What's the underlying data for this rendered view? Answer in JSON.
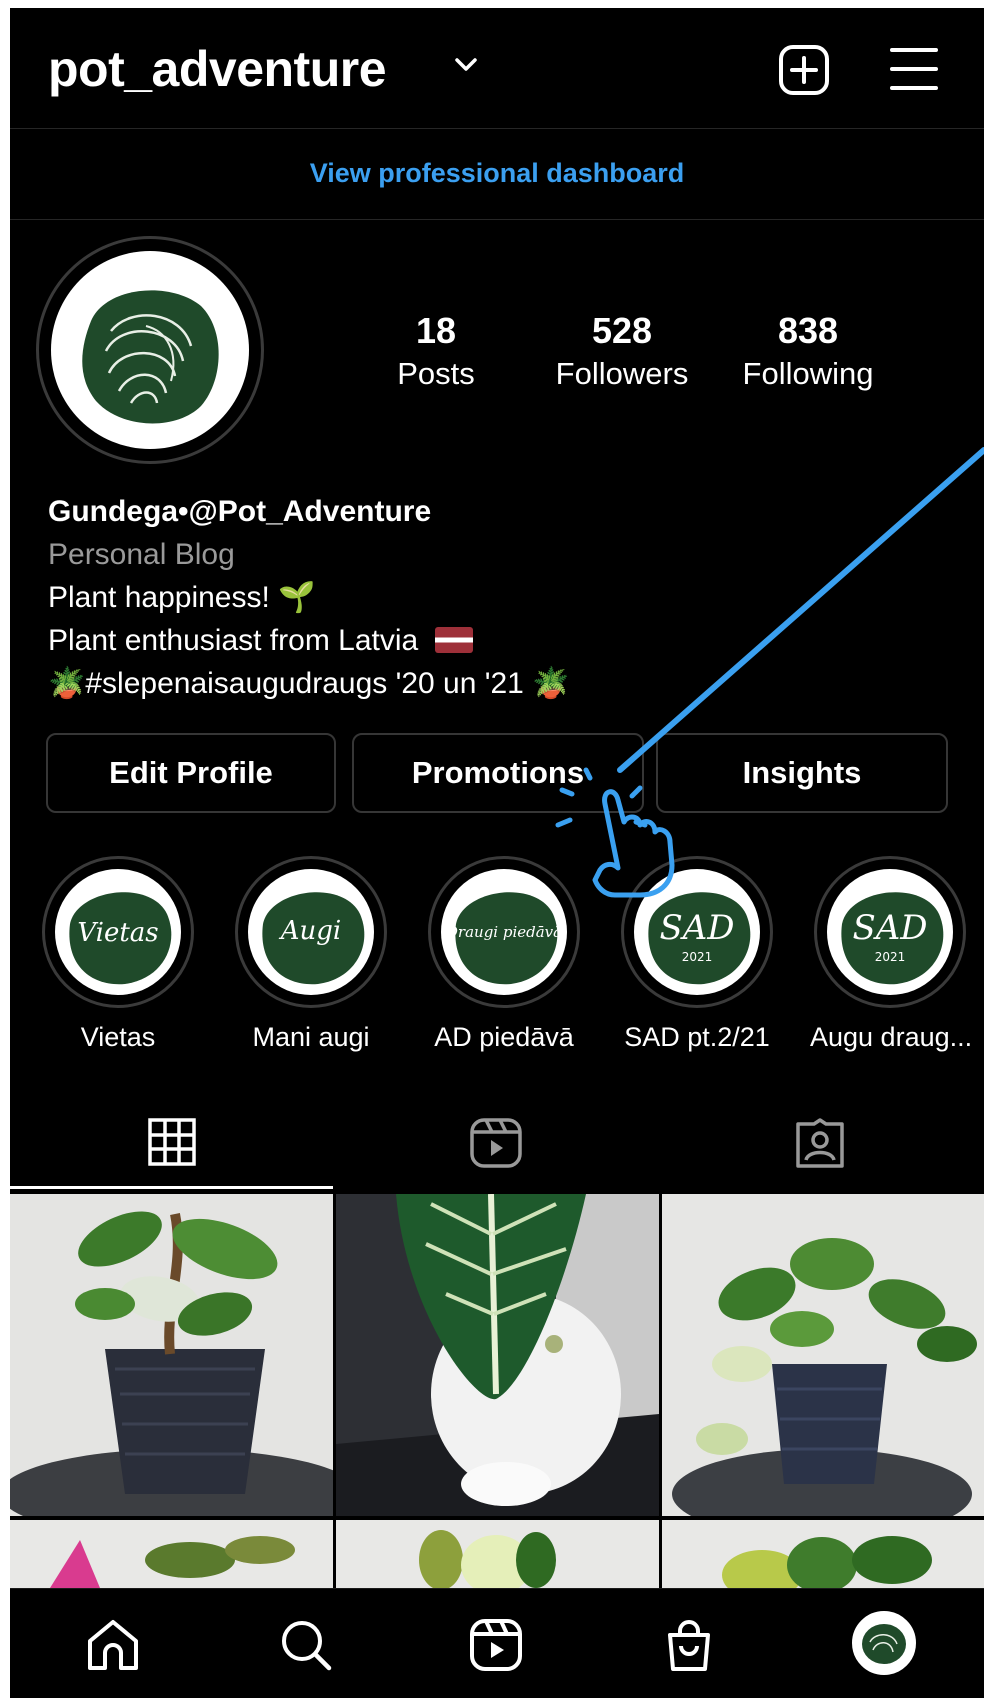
{
  "colors": {
    "background": "#000000",
    "accent_blue": "#3b9ff0",
    "muted_text": "#9a9a9a",
    "border": "#363636"
  },
  "header": {
    "username": "pot_adventure",
    "icons": [
      "chevron-down-icon",
      "plus-square-icon",
      "hamburger-menu-icon"
    ]
  },
  "dashboard_link": "View professional dashboard",
  "profile": {
    "stats": [
      {
        "value": "18",
        "label": "Posts"
      },
      {
        "value": "528",
        "label": "Followers"
      },
      {
        "value": "838",
        "label": "Following"
      }
    ],
    "name": "Gundega•@Pot_Adventure",
    "category": "Personal Blog",
    "bio_lines": [
      "Plant happiness! 🌱",
      "Plant enthusiast from Latvia",
      "🪴#slepenaisaugudraugs  '20 un '21 🪴"
    ]
  },
  "buttons": {
    "edit": "Edit Profile",
    "promotions": "Promotions",
    "insights": "Insights"
  },
  "highlights": [
    {
      "cover_text": "Vietas",
      "label": "Vietas"
    },
    {
      "cover_text": "Augi",
      "label": "Mani augi"
    },
    {
      "cover_text": "Draugi piedāvā",
      "label": "AD piedāvā"
    },
    {
      "cover_text": "SAD",
      "cover_sub": "2021",
      "label": "SAD pt.2/21"
    },
    {
      "cover_text": "SAD",
      "cover_sub": "2021",
      "label": "Augu draug..."
    }
  ],
  "tabs": [
    "grid-icon",
    "reels-icon",
    "tagged-icon"
  ],
  "bottom_nav": [
    "home-icon",
    "search-icon",
    "reels-icon",
    "shop-icon",
    "profile-avatar"
  ]
}
